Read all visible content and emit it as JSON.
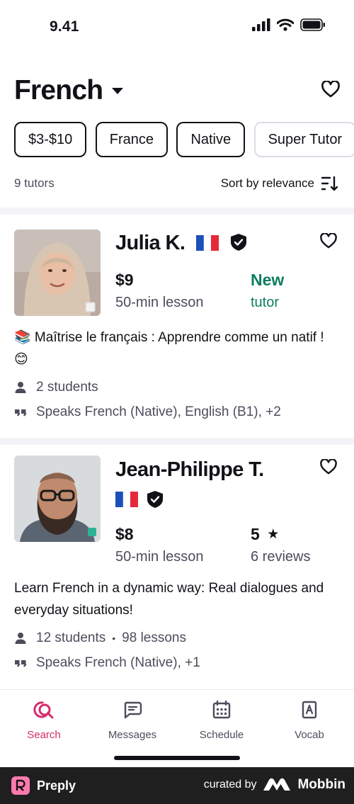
{
  "status_bar": {
    "time": "9.41"
  },
  "header": {
    "language": "French"
  },
  "filters": [
    "$3-$10",
    "France",
    "Native",
    "Super Tutor"
  ],
  "results": {
    "count": "9 tutors",
    "sort_label": "Sort by relevance"
  },
  "tutors": [
    {
      "name": "Julia K.",
      "price": "$9",
      "lesson_length": "50-min lesson",
      "badge_title": "New",
      "badge_sub": "tutor",
      "headline": "📚 Maîtrise le français : Apprendre comme un natif ! 😊",
      "students": "2 students",
      "languages": "Speaks French (Native), English (B1), +2"
    },
    {
      "name": "Jean-Philippe T.",
      "price": "$8",
      "lesson_length": "50-min lesson",
      "rating": "5",
      "reviews": "6 reviews",
      "headline": "Learn French in a dynamic way: Real dialogues and everyday situations!",
      "students": "12 students",
      "separator": "•",
      "lessons": "98 lessons",
      "languages": "Speaks French (Native), +1"
    }
  ],
  "tabs": [
    {
      "label": "Search",
      "icon": "search-icon",
      "active": true
    },
    {
      "label": "Messages",
      "icon": "messages-icon",
      "active": false
    },
    {
      "label": "Schedule",
      "icon": "calendar-icon",
      "active": false
    },
    {
      "label": "Vocab",
      "icon": "vocab-icon",
      "active": false
    }
  ],
  "footer": {
    "brand": "Preply",
    "curated_by": "curated by",
    "curator": "Mobbin"
  },
  "colors": {
    "accent": "#d62b6b",
    "new_tutor": "#0e7d5f",
    "online": "#2bb393",
    "text": "#121117",
    "muted": "#4d4c5c"
  }
}
